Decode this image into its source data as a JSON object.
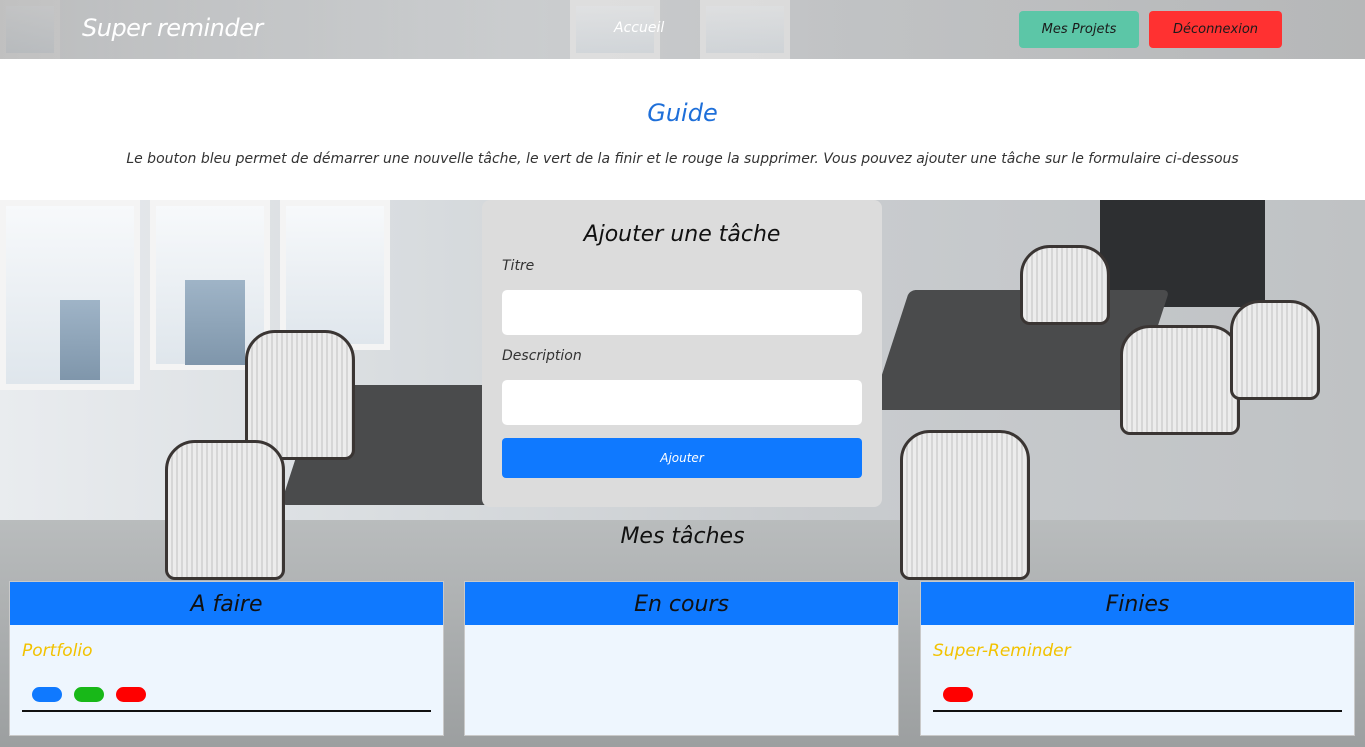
{
  "navbar": {
    "brand": "Super reminder",
    "home_link": "Accueil",
    "projects_button": "Mes Projets",
    "logout_button": "Déconnexion"
  },
  "guide": {
    "title": "Guide",
    "text": "Le bouton bleu permet de démarrer une nouvelle tâche, le vert de la finir et le rouge la supprimer. Vous pouvez ajouter une tâche sur le formulaire ci-dessous"
  },
  "form": {
    "title": "Ajouter une tâche",
    "title_label": "Titre",
    "title_value": "",
    "description_label": "Description",
    "description_value": "",
    "submit_button": "Ajouter"
  },
  "tasks": {
    "heading": "Mes tâches",
    "columns": [
      {
        "title": "A faire",
        "items": [
          {
            "title": "Portfolio",
            "actions": [
              "start",
              "finish",
              "delete"
            ]
          }
        ]
      },
      {
        "title": "En cours",
        "items": []
      },
      {
        "title": "Finies",
        "items": [
          {
            "title": "Super-Reminder",
            "actions": [
              "delete"
            ]
          }
        ]
      }
    ]
  },
  "colors": {
    "primary": "#0f79ff",
    "success": "#18b818",
    "danger": "#ff0000",
    "projects_button": "#5cc6a7",
    "logout_button": "#ff3131",
    "task_title": "#f2c200",
    "guide_title": "#1e6fd9"
  }
}
